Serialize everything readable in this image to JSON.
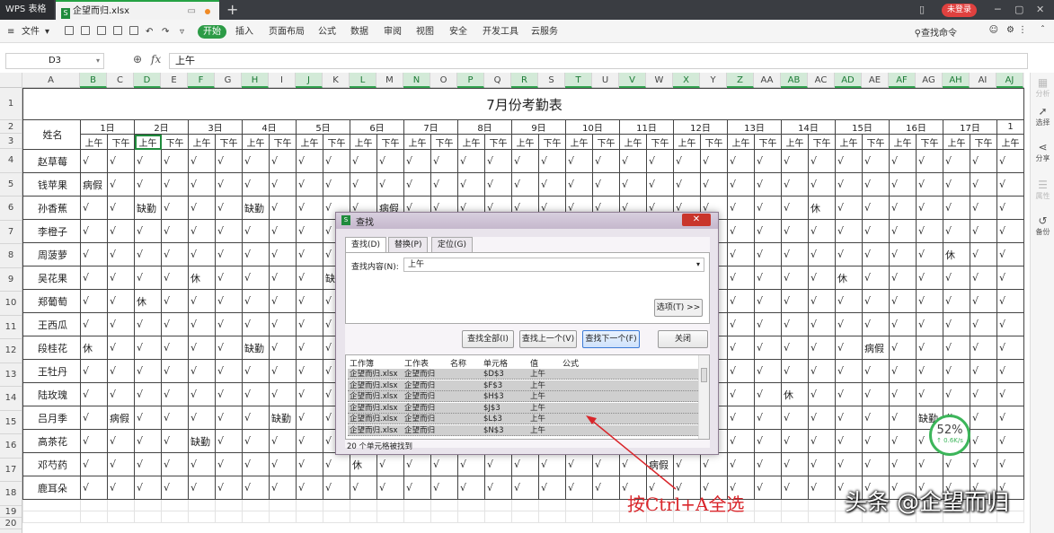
{
  "titlebar": {
    "app": "WPS 表格",
    "file_tab": "企望而归.xlsx",
    "login": "未登录",
    "new_tab": "+"
  },
  "menubar": {
    "file": "文件",
    "start": "开始",
    "items": [
      "插入",
      "页面布局",
      "公式",
      "数据",
      "审阅",
      "视图",
      "安全",
      "开发工具",
      "云服务"
    ],
    "search": "查找命令"
  },
  "formula": {
    "cell_ref": "D3",
    "fx": "fx",
    "value": "上午"
  },
  "columns": [
    "A",
    "B",
    "C",
    "D",
    "E",
    "F",
    "G",
    "H",
    "I",
    "J",
    "K",
    "L",
    "M",
    "N",
    "O",
    "P",
    "Q",
    "R",
    "S",
    "T",
    "U",
    "V",
    "W",
    "X",
    "Y",
    "Z",
    "AA",
    "AB",
    "AC",
    "AD",
    "AE",
    "AF",
    "AG",
    "AH",
    "AI",
    "AJ"
  ],
  "selected_columns": [
    "B",
    "D",
    "F",
    "H",
    "J",
    "L",
    "N",
    "P",
    "R",
    "T",
    "V",
    "X",
    "Z",
    "AB",
    "AD",
    "AF",
    "AH",
    "AJ"
  ],
  "rows": [
    "1",
    "2",
    "3",
    "4",
    "5",
    "6",
    "7",
    "8",
    "9",
    "10",
    "11",
    "12",
    "13",
    "14",
    "15",
    "16",
    "17",
    "18",
    "19",
    "20"
  ],
  "sheet": {
    "title": "7月份考勤表",
    "name_header": "姓名",
    "days": [
      "1日",
      "2日",
      "3日",
      "4日",
      "5日",
      "6日",
      "7日",
      "8日",
      "9日",
      "10日",
      "11日",
      "12日",
      "13日",
      "14日",
      "15日",
      "16日",
      "17日",
      "1"
    ],
    "am": "上午",
    "pm": "下午",
    "check": "√",
    "employees": [
      {
        "name": "赵草莓",
        "marks": {}
      },
      {
        "name": "钱苹果",
        "marks": {
          "0": "病假"
        }
      },
      {
        "name": "孙香蕉",
        "marks": {
          "2": "缺勤",
          "6": "缺勤",
          "11": "病假",
          "27": "休"
        }
      },
      {
        "name": "李橙子",
        "marks": {}
      },
      {
        "name": "周菠萝",
        "marks": {
          "32": "休"
        }
      },
      {
        "name": "吴花果",
        "marks": {
          "4": "休",
          "9": "缺",
          "28": "休"
        }
      },
      {
        "name": "郑葡萄",
        "marks": {
          "2": "休"
        }
      },
      {
        "name": "王西瓜",
        "marks": {}
      },
      {
        "name": "段桂花",
        "marks": {
          "0": "休",
          "6": "缺勤",
          "29": "病假"
        }
      },
      {
        "name": "王牡丹",
        "marks": {}
      },
      {
        "name": "陆玫瑰",
        "marks": {
          "26": "休"
        }
      },
      {
        "name": "吕月季",
        "marks": {
          "1": "病假",
          "7": "缺勤",
          "31": "缺勤",
          "32": "休"
        }
      },
      {
        "name": "高茶花",
        "marks": {
          "4": "缺勤"
        }
      },
      {
        "name": "邓芍药",
        "marks": {
          "10": "休",
          "21": "病假"
        }
      },
      {
        "name": "鹿耳朵",
        "marks": {}
      }
    ]
  },
  "side_panel": [
    "分析",
    "选择",
    "分享",
    "属性",
    "备份"
  ],
  "dialog": {
    "title": "查找",
    "close": "✕",
    "tabs": [
      "查找(D)",
      "替换(P)",
      "定位(G)"
    ],
    "find_label": "查找内容(N):",
    "find_value": "上午",
    "options_btn": "选项(T) >>",
    "buttons": [
      "查找全部(I)",
      "查找上一个(V)",
      "查找下一个(F)",
      "关闭"
    ],
    "result_headers": [
      "工作簿",
      "工作表",
      "名称",
      "单元格",
      "值",
      "公式"
    ],
    "results": [
      {
        "book": "企望而归.xlsx",
        "sheet": "企望而归",
        "cell": "$D$3",
        "value": "上午"
      },
      {
        "book": "企望而归.xlsx",
        "sheet": "企望而归",
        "cell": "$F$3",
        "value": "上午"
      },
      {
        "book": "企望而归.xlsx",
        "sheet": "企望而归",
        "cell": "$H$3",
        "value": "上午"
      },
      {
        "book": "企望而归.xlsx",
        "sheet": "企望而归",
        "cell": "$J$3",
        "value": "上午"
      },
      {
        "book": "企望而归.xlsx",
        "sheet": "企望而归",
        "cell": "$L$3",
        "value": "上午"
      },
      {
        "book": "企望而归.xlsx",
        "sheet": "企望而归",
        "cell": "$N$3",
        "value": "上午"
      }
    ],
    "status": "20 个单元格被找到"
  },
  "annotation": "按Ctrl+A全选",
  "watermark": "头条 @企望而归",
  "speed": {
    "percent": "52%",
    "rate": "↑ 0.6K/s"
  },
  "colors": {
    "accent": "#2c9b46",
    "annotation": "#d9262b",
    "dialog_close": "#c9352b"
  }
}
